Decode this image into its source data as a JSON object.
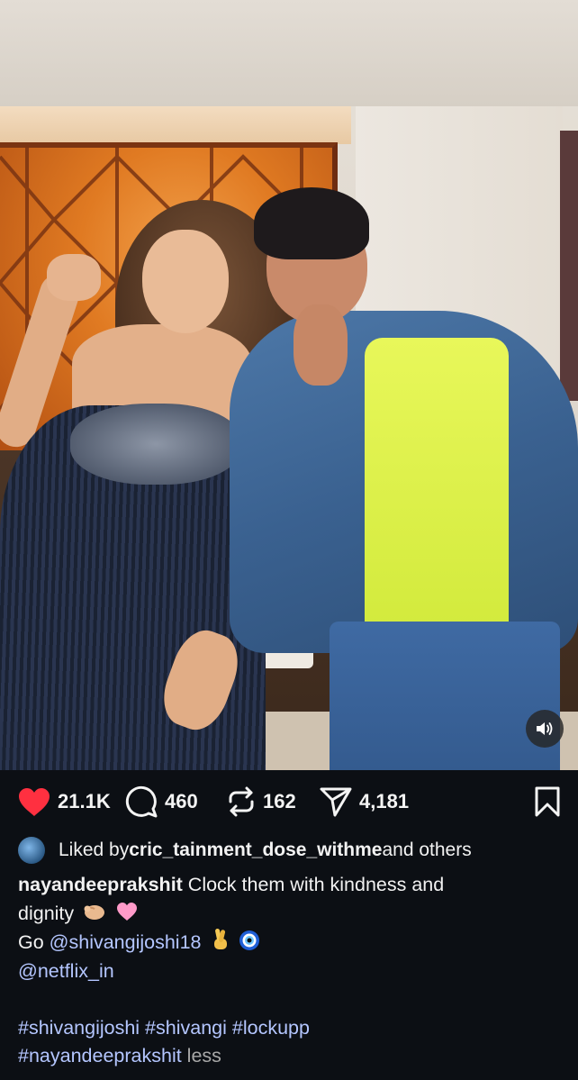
{
  "post": {
    "sound_icon": "speaker-icon",
    "actions": {
      "like": {
        "icon": "heart-filled-icon",
        "count": "21.1K",
        "color": "#ff3040"
      },
      "comment": {
        "icon": "comment-bubble-icon",
        "count": "460"
      },
      "repost": {
        "icon": "repost-icon",
        "count": "162"
      },
      "share": {
        "icon": "send-icon",
        "count": "4,181"
      },
      "save": {
        "icon": "bookmark-icon"
      }
    },
    "liked_by": {
      "prefix": "Liked by ",
      "user": "cric_tainment_dose_withme",
      "suffix": " and others"
    },
    "caption": {
      "author": "nayandeeprakshit",
      "text_line1": " Clock them with kindness and",
      "text_line2": "dignity",
      "emoji_line2": [
        "pinching-hand-emoji",
        "pink-heart-emoji"
      ],
      "go_prefix": "Go ",
      "mention1": "@shivangijoshi18",
      "emoji_line3": [
        "crossed-fingers-emoji",
        "nazar-amulet-emoji"
      ],
      "mention2": "@netflix_in",
      "hashtags_line1": [
        "#shivangijoshi",
        "#shivangi",
        "#lockupp"
      ],
      "hashtag_line2": "#nayandeeprakshit",
      "less_label": " less"
    },
    "colors": {
      "background": "#0c0f14",
      "link": "#b4c6ff",
      "muted": "#a8a8a8"
    }
  }
}
